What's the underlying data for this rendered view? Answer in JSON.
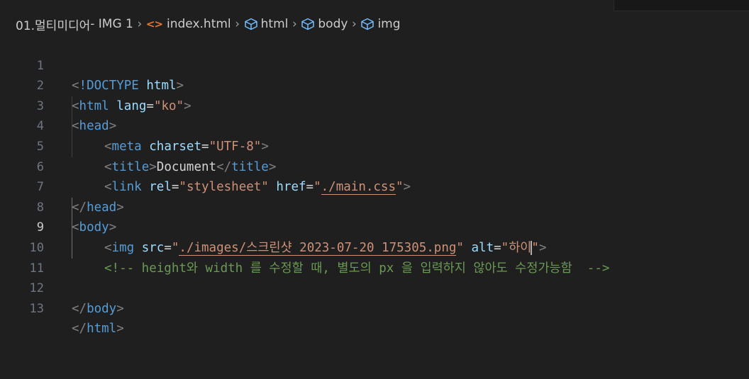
{
  "breadcrumb": {
    "folder": "01.멀티미디어",
    "section": " - IMG 1",
    "file": "index.html",
    "nodes": [
      "html",
      "body",
      "img"
    ]
  },
  "icons": {
    "file": "html-file-icon",
    "node": "cube-icon",
    "separator": "chevron-right-icon"
  },
  "editor": {
    "active_line": 9,
    "lines": [
      {
        "num": "1"
      },
      {
        "num": "2"
      },
      {
        "num": "3"
      },
      {
        "num": "4"
      },
      {
        "num": "5"
      },
      {
        "num": "6"
      },
      {
        "num": "7"
      },
      {
        "num": "8"
      },
      {
        "num": "9"
      },
      {
        "num": "10"
      },
      {
        "num": "11"
      },
      {
        "num": "12"
      },
      {
        "num": "13"
      }
    ],
    "code": {
      "l1": {
        "open": "<",
        "decl": "!DOCTYPE",
        "name": "html",
        "close": ">"
      },
      "l2": {
        "open": "<",
        "tag": "html",
        "attr": "lang",
        "eq": "=",
        "value": "\"ko\"",
        "close": ">"
      },
      "l3": {
        "open": "<",
        "tag": "head",
        "close": ">"
      },
      "l4": {
        "open": "<",
        "tag": "meta",
        "attr": "charset",
        "eq": "=",
        "value": "\"UTF-8\"",
        "close": ">"
      },
      "l5": {
        "open": "<",
        "tag": "title",
        "close": ">",
        "text": "Document",
        "end_open": "</",
        "end_tag": "title",
        "end_close": ">"
      },
      "l6": {
        "open": "<",
        "tag": "link",
        "attr1": "rel",
        "eq1": "=",
        "value1": "\"stylesheet\"",
        "attr2": "href",
        "eq2": "=",
        "q_open": "\"",
        "link": "./main.css",
        "q_close": "\"",
        "close": ">"
      },
      "l7": {
        "open": "</",
        "tag": "head",
        "close": ">"
      },
      "l8": {
        "open": "<",
        "tag": "body",
        "close": ">"
      },
      "l9": {
        "open": "<",
        "tag": "img",
        "attr1": "src",
        "eq1": "=",
        "q_open": "\"",
        "link": "./images/스크린샷 2023-07-20 175305.png",
        "q_close": "\"",
        "attr2": "alt",
        "eq2": "=",
        "value2_before_cursor": "\"하이",
        "value2_after_cursor": "\"",
        "close": ">"
      },
      "l10": {
        "comment": "<!-- height와 width 를 수정할 때, 별도의 px 을 입력하지 않아도 수정가능함  -->"
      },
      "l12": {
        "open": "</",
        "tag": "body",
        "close": ">"
      },
      "l13": {
        "open": "</",
        "tag": "html",
        "close": ">"
      }
    }
  },
  "colors": {
    "background": "#1f1f1f",
    "tag": "#569cd6",
    "attribute": "#9cdcfe",
    "string": "#ce9178",
    "comment": "#6a9955",
    "html_icon": "#e37933"
  }
}
